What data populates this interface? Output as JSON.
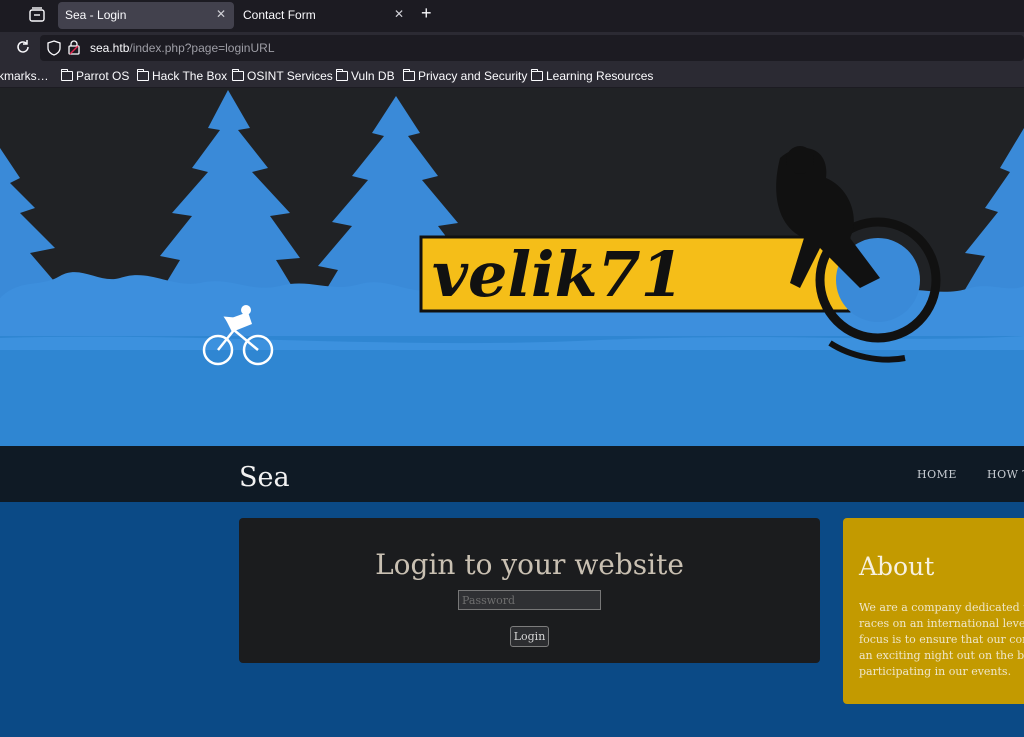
{
  "browser": {
    "tabs": [
      {
        "title": "Sea - Login",
        "active": true
      },
      {
        "title": "Contact Form",
        "active": false
      }
    ],
    "url_host": "sea.htb",
    "url_path": "/index.php?page=loginURL",
    "bookmarks": [
      "kmarks…",
      "Parrot OS",
      "Hack The Box",
      "OSINT Services",
      "Vuln DB",
      "Privacy and Security",
      "Learning Resources"
    ]
  },
  "banner": {
    "logo_text": "velik71",
    "colors": {
      "sky": "#202225",
      "trees": "#3a8ad8",
      "ground": "#2f86d2",
      "logo_bg": "#f5be18"
    }
  },
  "site": {
    "brand": "Sea",
    "menu": [
      "HOME",
      "HOW T"
    ]
  },
  "login": {
    "title": "Login to your website",
    "password_placeholder": "Password",
    "button_label": "Login"
  },
  "about": {
    "title": "About",
    "lines": [
      "We are a company dedicated to",
      "races on an international level.",
      "focus is to ensure that our comp",
      "an exciting night out on the bik",
      "participating in our events."
    ]
  }
}
